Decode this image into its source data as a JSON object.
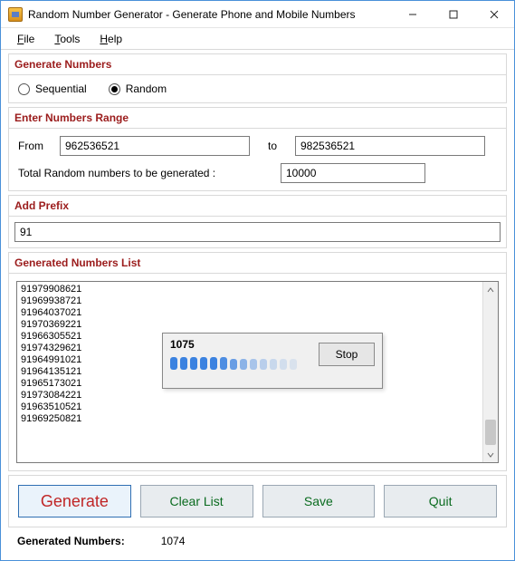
{
  "window": {
    "title": "Random Number Generator - Generate Phone and Mobile Numbers"
  },
  "menu": {
    "file": "File",
    "tools": "Tools",
    "help": "Help"
  },
  "sections": {
    "generate_numbers": "Generate Numbers",
    "enter_range": "Enter Numbers Range",
    "add_prefix": "Add Prefix",
    "generated_list": "Generated Numbers List"
  },
  "radios": {
    "sequential": "Sequential",
    "random": "Random",
    "selected": "random"
  },
  "range": {
    "from_label": "From",
    "to_label": "to",
    "from_value": "962536521",
    "to_value": "982536521",
    "total_label": "Total Random numbers to be generated :",
    "total_value": "10000"
  },
  "prefix": {
    "value": "91"
  },
  "list": {
    "numbers": [
      "91979908621",
      "91969938721",
      "91964037021",
      "91970369221",
      "91966305521",
      "91974329621",
      "91964991021",
      "91964135121",
      "91965173021",
      "91973084221",
      "91963510521",
      "91969250821"
    ]
  },
  "progress": {
    "count": "1075",
    "stop": "Stop"
  },
  "buttons": {
    "generate": "Generate",
    "clear": "Clear List",
    "save": "Save",
    "quit": "Quit"
  },
  "status": {
    "label": "Generated Numbers:",
    "value": "1074"
  }
}
